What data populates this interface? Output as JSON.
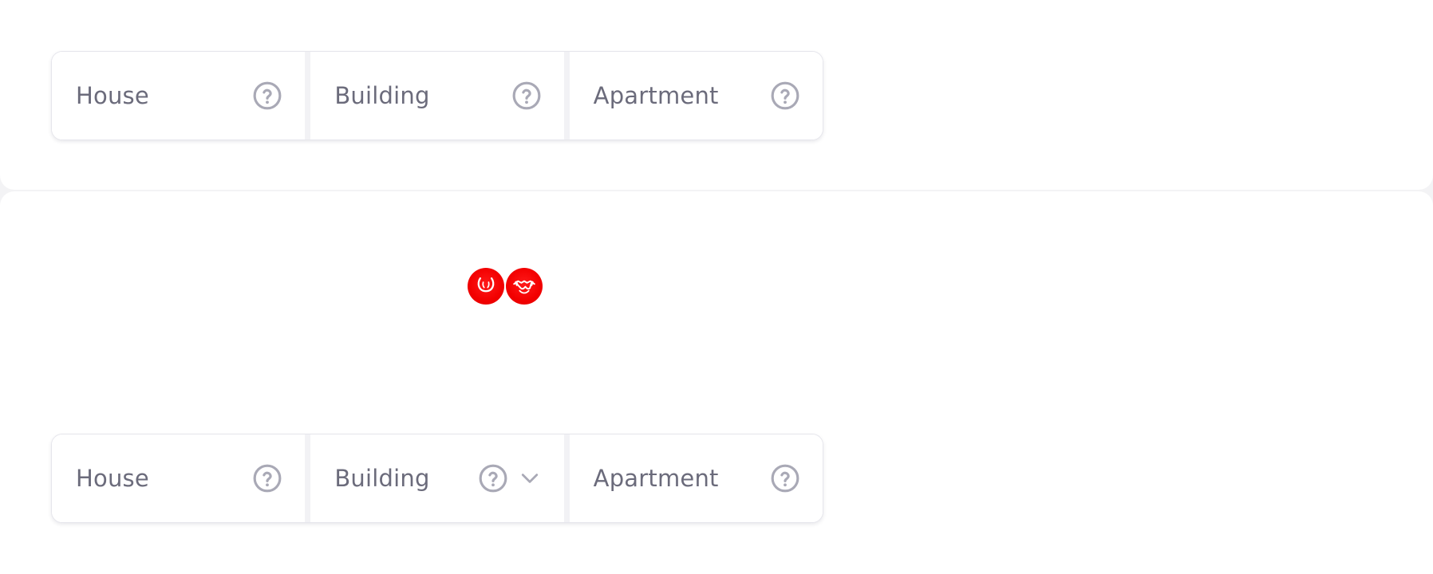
{
  "segmented_top": {
    "options": [
      {
        "label": "House",
        "icon": "help-circle-icon"
      },
      {
        "label": "Building",
        "icon": "help-circle-icon"
      },
      {
        "label": "Apartment",
        "icon": "help-circle-icon"
      }
    ]
  },
  "avatars": {
    "items": [
      {
        "icon": "horns-avatar-icon"
      },
      {
        "icon": "handshake-avatar-icon"
      }
    ]
  },
  "segmented_bottom": {
    "options": [
      {
        "label": "House",
        "icon": "help-circle-icon"
      },
      {
        "label": "Building",
        "icon": "help-circle-icon",
        "trailing_icon": "chevron-down-icon"
      },
      {
        "label": "Apartment",
        "icon": "help-circle-icon"
      }
    ]
  },
  "colors": {
    "label_text": "#6b6b7b",
    "icon_gray": "#a9a9b6",
    "avatar_red": "#f20000",
    "divider": "#f2f2f5"
  }
}
